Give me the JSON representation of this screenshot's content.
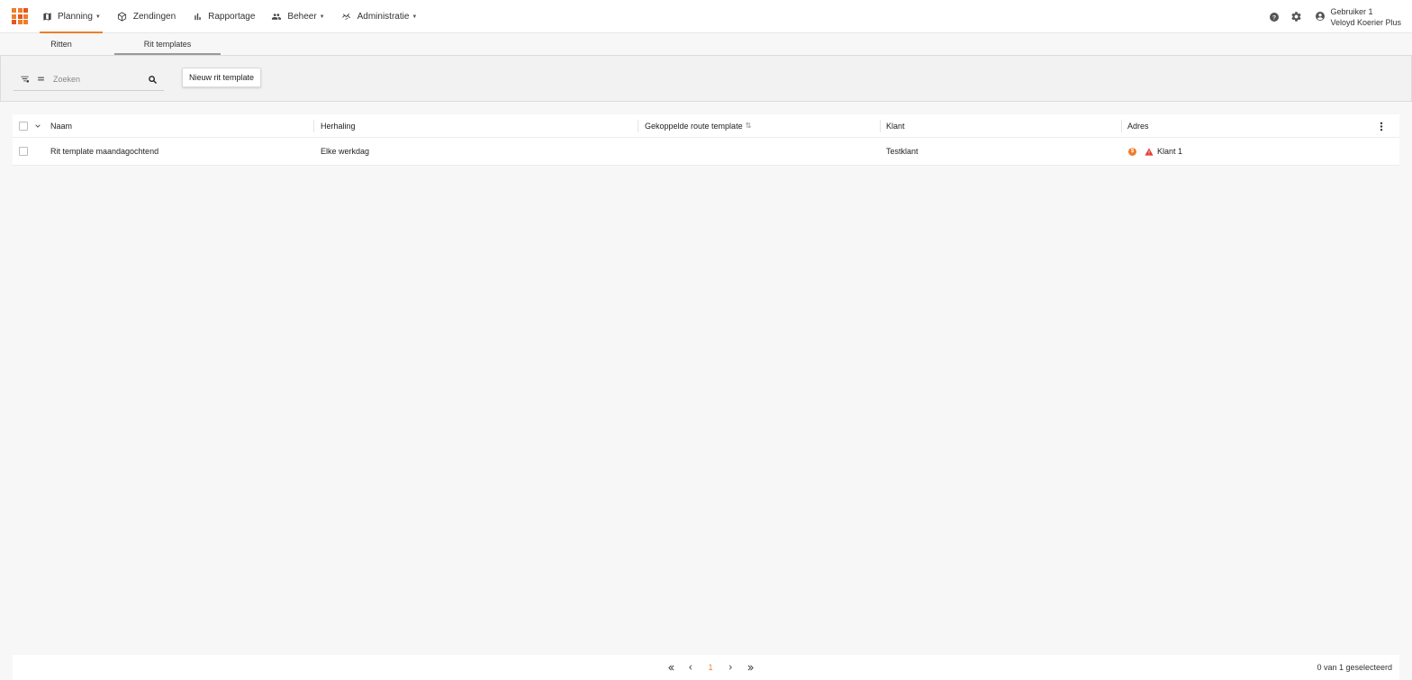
{
  "nav": {
    "items": [
      {
        "label": "Planning",
        "icon": "map-icon",
        "has_caret": true,
        "active": true
      },
      {
        "label": "Zendingen",
        "icon": "package-icon",
        "has_caret": false,
        "active": false
      },
      {
        "label": "Rapportage",
        "icon": "bar-chart-icon",
        "has_caret": false,
        "active": false
      },
      {
        "label": "Beheer",
        "icon": "group-icon",
        "has_caret": true,
        "active": false
      },
      {
        "label": "Administratie",
        "icon": "handshake-icon",
        "has_caret": true,
        "active": false
      }
    ]
  },
  "user": {
    "name": "Gebruiker 1",
    "company": "Veloyd Koerier Plus"
  },
  "tabs": [
    {
      "label": "Ritten",
      "active": false
    },
    {
      "label": "Rit templates",
      "active": true
    }
  ],
  "search": {
    "placeholder": "Zoeken",
    "value": ""
  },
  "toolbar": {
    "new_button_label": "Nieuw rit template"
  },
  "table": {
    "columns": [
      "Naam",
      "Herhaling",
      "Gekoppelde route template",
      "Klant",
      "Adres"
    ],
    "sort_indicator": "⇅",
    "rows": [
      {
        "naam": "Rit template maandagochtend",
        "herhaling": "Elke werkdag",
        "route_template": "",
        "klant": "Testklant",
        "adres_badge": "$",
        "adres": "Klant 1"
      }
    ]
  },
  "pagination": {
    "current_page": "1",
    "selection_text": "0 van 1 geselecteerd"
  },
  "colors": {
    "accent": "#f07d2a",
    "warning": "#e53935"
  }
}
